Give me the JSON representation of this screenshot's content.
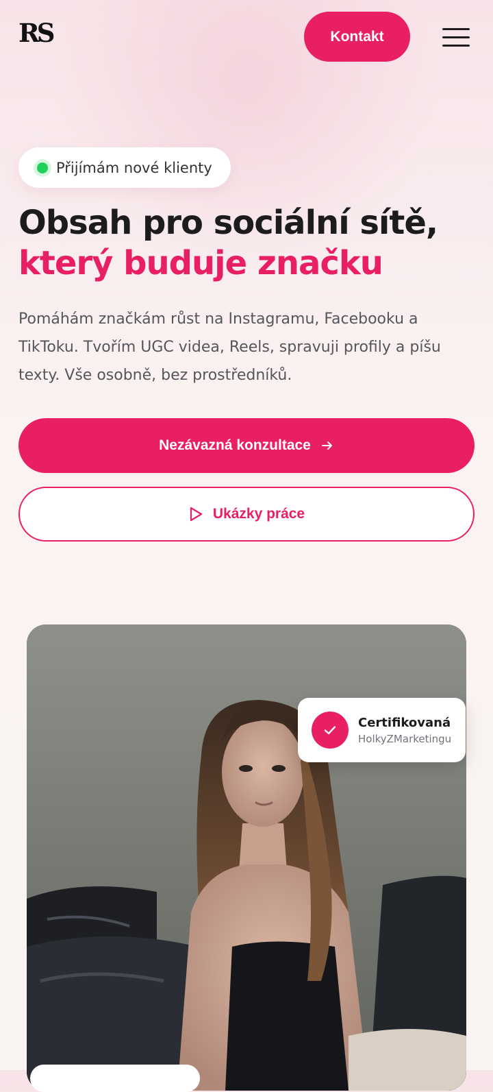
{
  "header": {
    "logo": "RS",
    "contact_label": "Kontakt"
  },
  "hero": {
    "status_label": "Přijímám nové klienty",
    "headline_line1": "Obsah pro sociální sítě,",
    "headline_line2": "který buduje značku",
    "intro": "Pomáhám značkám růst na Instagramu, Facebooku a TikToku. Tvořím UGC videa, Reels, spravuji profily a píšu texty. Vše osobně, bez prostředníků.",
    "primary_cta": "Nezávazná konzultace",
    "secondary_cta": "Ukázky práce"
  },
  "certificate": {
    "title": "Certifikovaná",
    "subtitle": "HolkyZMarketingu"
  },
  "icons": {
    "menu": "hamburger-icon",
    "status": "status-dot-icon",
    "arrow": "arrow-right-icon",
    "play": "play-icon",
    "check": "check-icon"
  },
  "colors": {
    "accent": "#e81f63",
    "status_green": "#1fd15b",
    "background": "#f9f2f1"
  }
}
